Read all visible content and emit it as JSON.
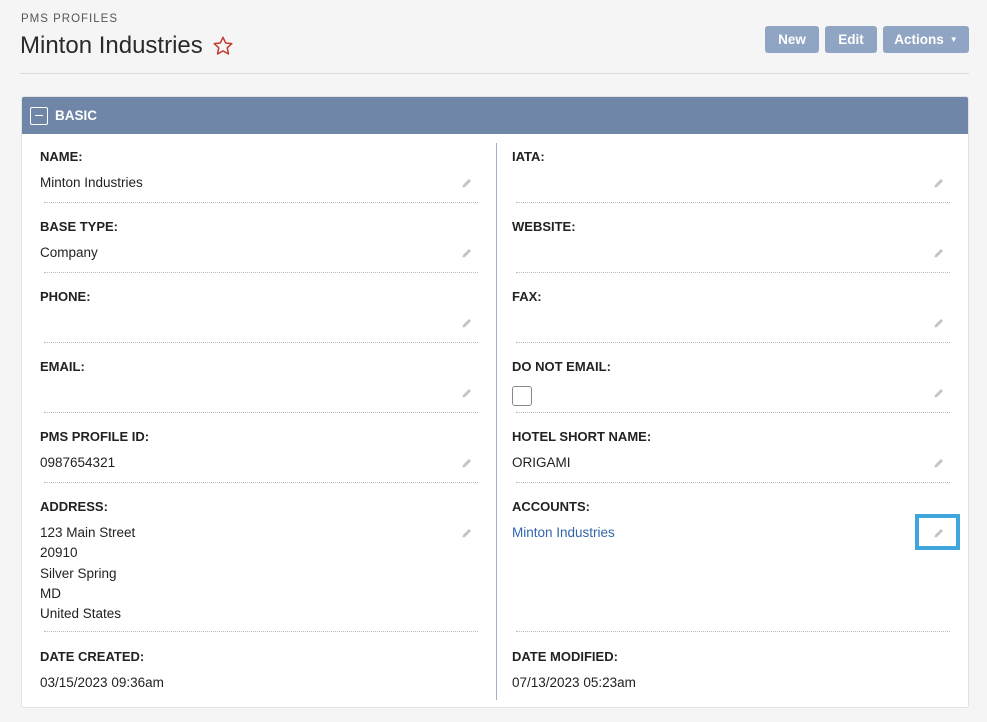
{
  "header": {
    "module": "PMS PROFILES",
    "title": "Minton Industries",
    "buttons": {
      "new": "New",
      "edit": "Edit",
      "actions": "Actions"
    }
  },
  "panel": {
    "title": "BASIC",
    "left": [
      {
        "label": "NAME:",
        "value": "Minton Industries"
      },
      {
        "label": "BASE TYPE:",
        "value": "Company"
      },
      {
        "label": "PHONE:",
        "value": ""
      },
      {
        "label": "EMAIL:",
        "value": ""
      },
      {
        "label": "PMS PROFILE ID:",
        "value": "0987654321"
      },
      {
        "label": "ADDRESS:",
        "lines": [
          "123 Main Street",
          "20910",
          "Silver Spring",
          "MD",
          "United States"
        ]
      },
      {
        "label": "DATE CREATED:",
        "value": "03/15/2023 09:36am"
      }
    ],
    "right": [
      {
        "label": "IATA:",
        "value": ""
      },
      {
        "label": "WEBSITE:",
        "value": ""
      },
      {
        "label": "FAX:",
        "value": ""
      },
      {
        "label": "DO NOT EMAIL:",
        "checked": false
      },
      {
        "label": "HOTEL SHORT NAME:",
        "value": "ORIGAMI"
      },
      {
        "label": "ACCOUNTS:",
        "value": "Minton Industries"
      },
      {
        "label": "DATE MODIFIED:",
        "value": "07/13/2023 05:23am"
      }
    ]
  },
  "colors": {
    "panel_header": "#6f86a8",
    "button": "#8fa5c3",
    "link": "#3366aa",
    "star": "#c0392b",
    "focus": "#3ea6dd"
  }
}
